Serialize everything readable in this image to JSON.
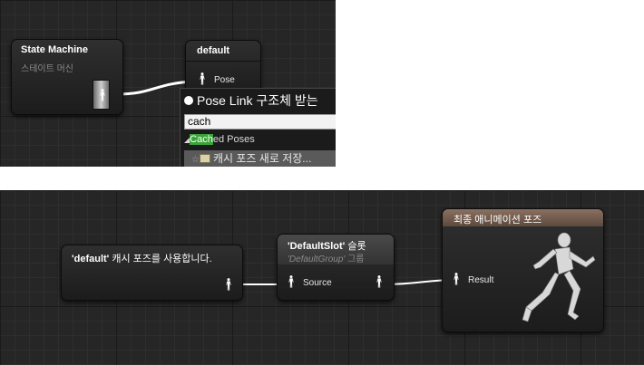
{
  "top_panel": {
    "state_machine_node": {
      "title": "State Machine",
      "subtitle": "스테이트 머신"
    },
    "default_node": {
      "title": "default",
      "pin_label": "Pose"
    },
    "context_menu": {
      "title": "Pose Link 구조체 받는",
      "search_value": "cach",
      "category_highlight": "Cach",
      "category_rest": "ed Poses",
      "item_label": "캐시 포즈 새로 저장..."
    }
  },
  "bottom_panel": {
    "use_cached_node": {
      "title_bold": "'default'",
      "title_rest": " 캐시 포즈를 사용합니다."
    },
    "slot_node": {
      "title_bold": "'DefaultSlot'",
      "title_rest": " 슬롯",
      "sub_italic": "'DefaultGroup'",
      "sub_rest": " 그룹",
      "pin_label": "Source"
    },
    "final_pose_node": {
      "title": "최종 애니메이션 포즈",
      "pin_label": "Result"
    }
  },
  "colors": {
    "graph_bg": "#262626",
    "wire": "#ffffff",
    "search_highlight": "#3aa43a",
    "menu_item_selected": "#5a5a5a"
  }
}
